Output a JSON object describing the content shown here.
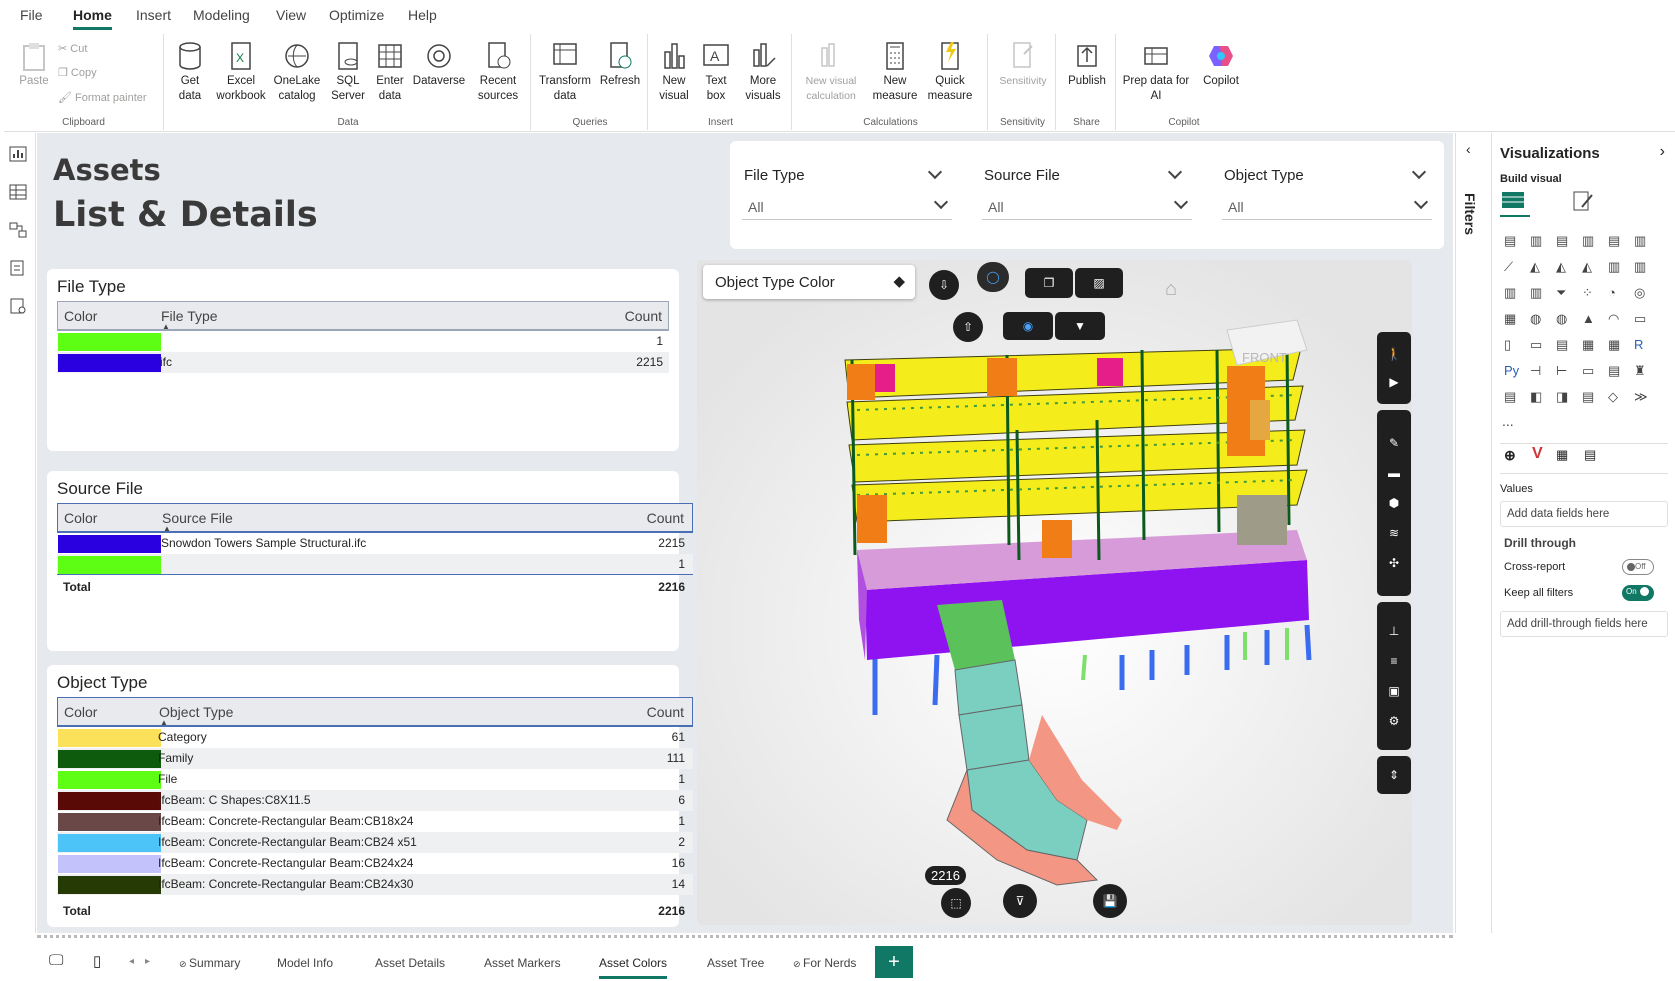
{
  "menu": {
    "items": [
      "File",
      "Home",
      "Insert",
      "Modeling",
      "View",
      "Optimize",
      "Help"
    ],
    "active": "Home"
  },
  "ribbon": {
    "clipboard": {
      "paste": "Paste",
      "cut": "Cut",
      "copy": "Copy",
      "format_painter": "Format painter",
      "label": "Clipboard"
    },
    "data": {
      "get_data": "Get\ndata",
      "excel": "Excel\nworkbook",
      "onelake": "OneLake\ncatalog",
      "sql": "SQL\nServer",
      "enter_data": "Enter\ndata",
      "dataverse": "Dataverse",
      "recent": "Recent\nsources",
      "label": "Data"
    },
    "queries": {
      "transform": "Transform\ndata",
      "refresh": "Refresh",
      "label": "Queries"
    },
    "insert": {
      "new_visual": "New\nvisual",
      "text_box": "Text\nbox",
      "more_visuals": "More\nvisuals",
      "label": "Insert"
    },
    "calculations": {
      "new_visual_calc": "New visual\ncalculation",
      "new_measure": "New\nmeasure",
      "quick_measure": "Quick\nmeasure",
      "label": "Calculations"
    },
    "sensitivity": {
      "btn": "Sensitivity",
      "label": "Sensitivity"
    },
    "share": {
      "publish": "Publish",
      "label": "Share"
    },
    "copilot": {
      "prep": "Prep data for\nAI",
      "copilot": "Copilot",
      "label": "Copilot"
    }
  },
  "report": {
    "title_line1": "Assets",
    "title_line2": "List & Details",
    "file_type_panel": {
      "title": "File Type",
      "headers": [
        "Color",
        "File Type",
        "Count"
      ],
      "rows": [
        {
          "color": "#5dfd14",
          "label": "",
          "count": "1"
        },
        {
          "color": "#2a00e0",
          "label": "ifc",
          "count": "2215"
        }
      ]
    },
    "source_file_panel": {
      "title": "Source File",
      "headers": [
        "Color",
        "Source File",
        "Count"
      ],
      "rows": [
        {
          "color": "#2a00e0",
          "label": "Snowdon Towers Sample Structural.ifc",
          "count": "2215"
        },
        {
          "color": "#5dfd14",
          "label": "",
          "count": "1"
        }
      ],
      "total_label": "Total",
      "total": "2216"
    },
    "object_type_panel": {
      "title": "Object Type",
      "headers": [
        "Color",
        "Object Type",
        "Count"
      ],
      "rows": [
        {
          "color": "#fbe05a",
          "label": "Category",
          "count": "61"
        },
        {
          "color": "#0e5b0e",
          "label": "Family",
          "count": "111"
        },
        {
          "color": "#5dfd14",
          "label": "File",
          "count": "1"
        },
        {
          "color": "#5a0a06",
          "label": "IfcBeam: C Shapes:C8X11.5",
          "count": "6"
        },
        {
          "color": "#6b4848",
          "label": "IfcBeam: Concrete-Rectangular Beam:CB18x24",
          "count": "1"
        },
        {
          "color": "#4dc4f7",
          "label": "IfcBeam: Concrete-Rectangular Beam:CB24 x51",
          "count": "2"
        },
        {
          "color": "#c4c2fb",
          "label": "IfcBeam: Concrete-Rectangular Beam:CB24x24",
          "count": "16"
        },
        {
          "color": "#263a06",
          "label": "IfcBeam: Concrete-Rectangular Beam:CB24x30",
          "count": "14"
        }
      ],
      "total_label": "Total",
      "total": "2216"
    },
    "slicers": [
      {
        "label": "File Type",
        "value": "All"
      },
      {
        "label": "Source File",
        "value": "All"
      },
      {
        "label": "Object Type",
        "value": "All"
      }
    ],
    "viewer": {
      "mode_select": "Object Type Color",
      "count_badge": "2216",
      "cube_label": "FRONT"
    }
  },
  "filters_label": "Filters",
  "viz_pane": {
    "title": "Visualizations",
    "build_visual": "Build visual",
    "values": "Values",
    "add_data": "Add data fields here",
    "drill": "Drill through",
    "cross_report": "Cross-report",
    "cross_state": "Off",
    "keep_filters": "Keep all filters",
    "keep_state": "On",
    "add_drill": "Add drill-through fields here",
    "more": "..."
  },
  "tabs": [
    "Summary",
    "Model Info",
    "Asset Details",
    "Asset Markers",
    "Asset Colors",
    "Asset Tree",
    "For Nerds"
  ],
  "active_tab": "Asset Colors",
  "colors": {
    "accent": "#117865",
    "canvas": "#e6e9ed"
  }
}
